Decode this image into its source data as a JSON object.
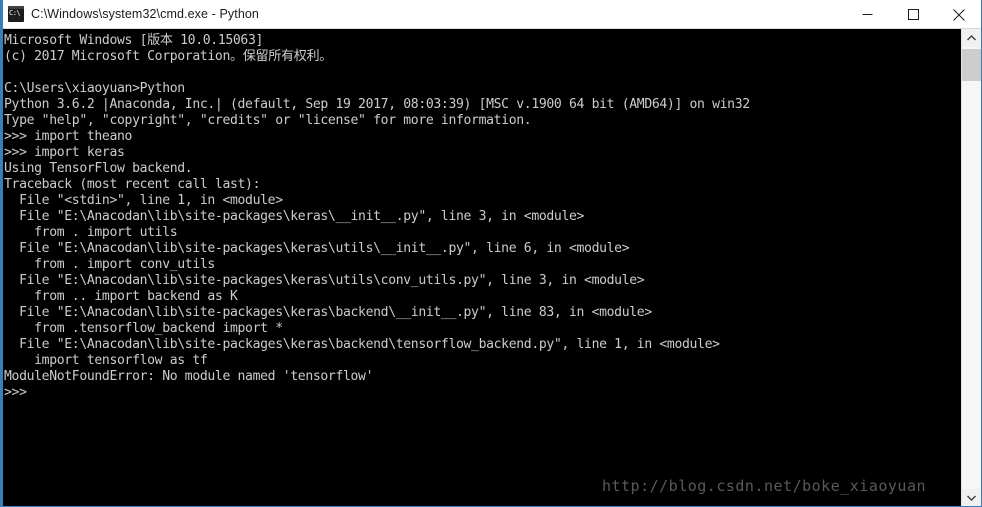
{
  "window": {
    "title": "C:\\Windows\\system32\\cmd.exe - Python",
    "icon": "cmd-console-icon",
    "controls": {
      "minimize_label": "Minimize",
      "maximize_label": "Maximize",
      "close_label": "Close"
    }
  },
  "console": {
    "background_color": "#000000",
    "foreground_color": "#cccccc",
    "lines": [
      "Microsoft Windows [版本 10.0.15063]",
      "(c) 2017 Microsoft Corporation。保留所有权利。",
      "",
      "C:\\Users\\xiaoyuan>Python",
      "Python 3.6.2 |Anaconda, Inc.| (default, Sep 19 2017, 08:03:39) [MSC v.1900 64 bit (AMD64)] on win32",
      "Type \"help\", \"copyright\", \"credits\" or \"license\" for more information.",
      ">>> import theano",
      ">>> import keras",
      "Using TensorFlow backend.",
      "Traceback (most recent call last):",
      "  File \"<stdin>\", line 1, in <module>",
      "  File \"E:\\Anacodan\\lib\\site-packages\\keras\\__init__.py\", line 3, in <module>",
      "    from . import utils",
      "  File \"E:\\Anacodan\\lib\\site-packages\\keras\\utils\\__init__.py\", line 6, in <module>",
      "    from . import conv_utils",
      "  File \"E:\\Anacodan\\lib\\site-packages\\keras\\utils\\conv_utils.py\", line 3, in <module>",
      "    from .. import backend as K",
      "  File \"E:\\Anacodan\\lib\\site-packages\\keras\\backend\\__init__.py\", line 83, in <module>",
      "    from .tensorflow_backend import *",
      "  File \"E:\\Anacodan\\lib\\site-packages\\keras\\backend\\tensorflow_backend.py\", line 1, in <module>",
      "    import tensorflow as tf",
      "ModuleNotFoundError: No module named 'tensorflow'",
      ">>>"
    ]
  },
  "watermark": {
    "text": "http://blog.csdn.net/boke_xiaoyuan",
    "color": "#5a5a5a"
  },
  "scrollbar": {
    "up_arrow": "chevron-up-icon",
    "down_arrow": "chevron-down-icon"
  }
}
